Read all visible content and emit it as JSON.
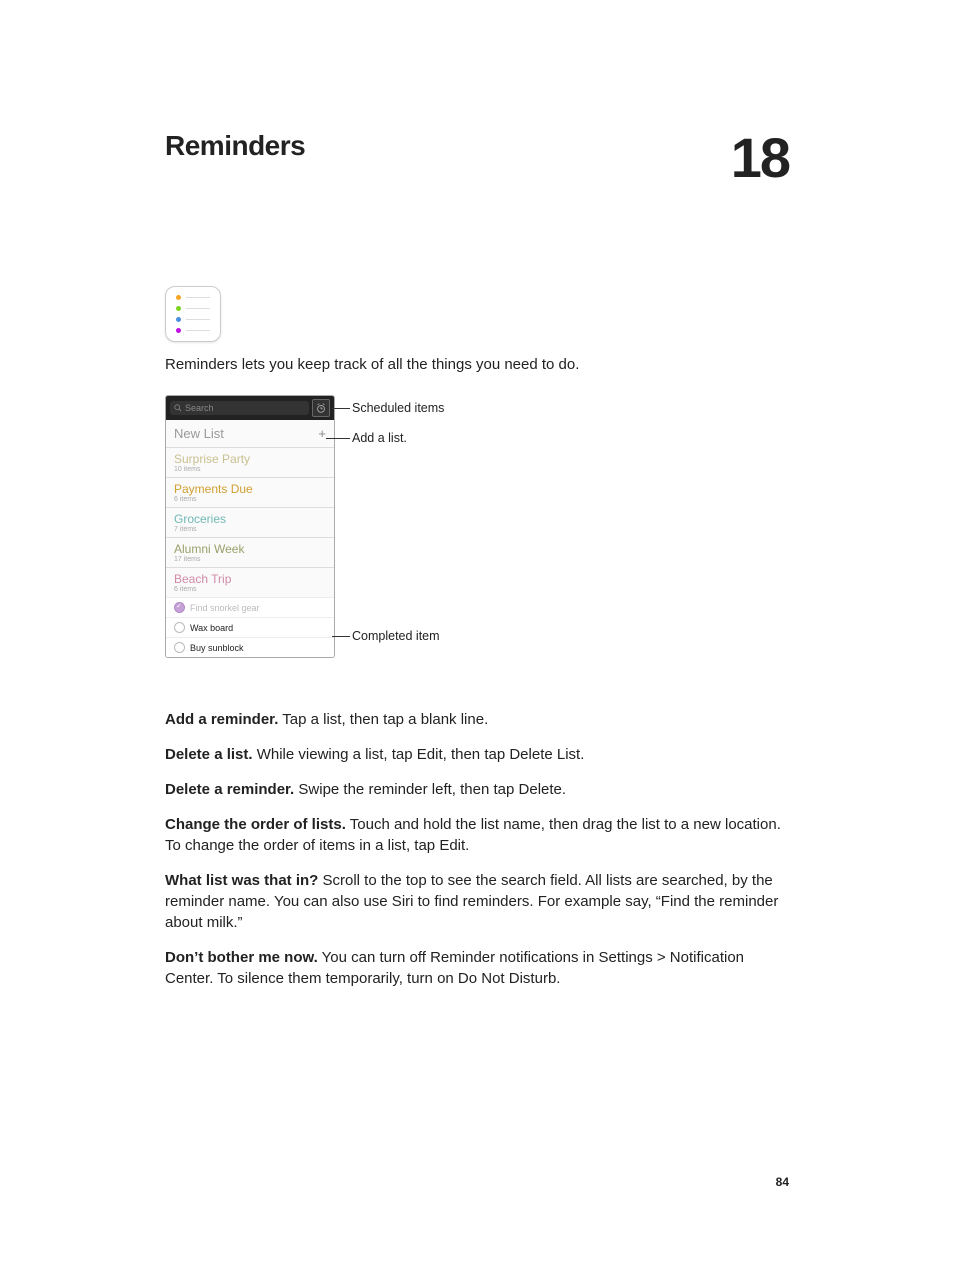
{
  "chapter": {
    "title": "Reminders",
    "number": "18"
  },
  "icon_dots": [
    "#f5a623",
    "#7ed321",
    "#4a90e2",
    "#bd10e0"
  ],
  "intro": "Reminders lets you keep track of all the things you need to do.",
  "screenshot": {
    "search_placeholder": "Search",
    "new_list_label": "New List",
    "lists": [
      {
        "name": "Surprise Party",
        "count": "10 items",
        "color": "#c9c08f"
      },
      {
        "name": "Payments Due",
        "count": "6 items",
        "color": "#d0a030"
      },
      {
        "name": "Groceries",
        "count": "7 items",
        "color": "#6fb8b5"
      },
      {
        "name": "Alumni Week",
        "count": "17 items",
        "color": "#9aa06a"
      },
      {
        "name": "Beach Trip",
        "count": "6 items",
        "color": "#d08aa8"
      }
    ],
    "beach_items": [
      {
        "label": "Find snorkel gear",
        "done": true
      },
      {
        "label": "Wax board",
        "done": false
      },
      {
        "label": "Buy sunblock",
        "done": false
      }
    ]
  },
  "callouts": {
    "scheduled": "Scheduled items",
    "add_list": "Add a list.",
    "completed": "Completed item"
  },
  "paragraphs": [
    {
      "bold": "Add a reminder.",
      "text": " Tap a list, then tap a blank line."
    },
    {
      "bold": "Delete a list.",
      "text": " While viewing a list, tap Edit, then tap Delete List."
    },
    {
      "bold": "Delete a reminder.",
      "text": " Swipe the reminder left, then tap Delete."
    },
    {
      "bold": "Change the order of lists.",
      "text": " Touch and hold the list name, then drag the list to a new location. To change the order of items in a list, tap Edit."
    },
    {
      "bold": "What list was that in?",
      "text": " Scroll to the top to see the search field. All lists are searched, by the reminder name. You can also use Siri to find reminders. For example say, “Find the reminder about milk.”"
    },
    {
      "bold": "Don’t bother me now.",
      "text": " You can turn off Reminder notifications in Settings > Notification Center. To silence them temporarily, turn on Do Not Disturb."
    }
  ],
  "page_number": "84"
}
